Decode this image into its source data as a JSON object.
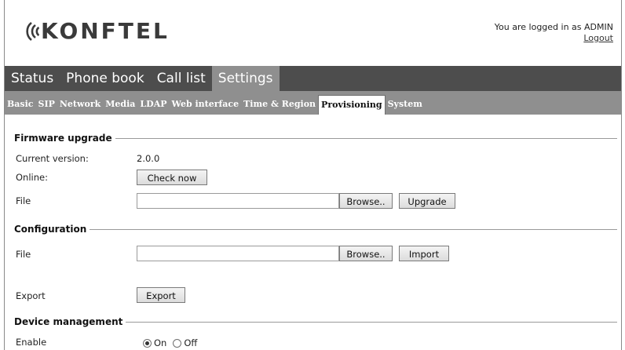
{
  "brand": {
    "name": "KONFTEL"
  },
  "login": {
    "text": "You are logged in as ADMIN",
    "logout": "Logout"
  },
  "main_tabs": [
    {
      "label": "Status",
      "active": false
    },
    {
      "label": "Phone book",
      "active": false
    },
    {
      "label": "Call list",
      "active": false
    },
    {
      "label": "Settings",
      "active": true
    }
  ],
  "sub_tabs": [
    {
      "label": "Basic",
      "active": false
    },
    {
      "label": "SIP",
      "active": false
    },
    {
      "label": "Network",
      "active": false
    },
    {
      "label": "Media",
      "active": false
    },
    {
      "label": "LDAP",
      "active": false
    },
    {
      "label": "Web interface",
      "active": false
    },
    {
      "label": "Time & Region",
      "active": false
    },
    {
      "label": "Provisioning",
      "active": true
    },
    {
      "label": "System",
      "active": false
    }
  ],
  "firmware": {
    "title": "Firmware upgrade",
    "current_version_label": "Current version:",
    "current_version_value": "2.0.0",
    "online_label": "Online:",
    "check_now": "Check now",
    "file_label": "File",
    "file_value": "",
    "browse": "Browse..",
    "upgrade": "Upgrade"
  },
  "configuration": {
    "title": "Configuration",
    "file_label": "File",
    "file_value": "",
    "browse": "Browse..",
    "import": "Import",
    "export_label": "Export",
    "export_button": "Export"
  },
  "device_management": {
    "title": "Device management",
    "enable_label": "Enable",
    "on_label": "On",
    "off_label": "Off",
    "selected": "On"
  },
  "colors": {
    "main_nav_bg": "#4d4d4d",
    "active_tab_bg": "#8f8f8f",
    "sub_nav_bg": "#8f8f8f"
  }
}
